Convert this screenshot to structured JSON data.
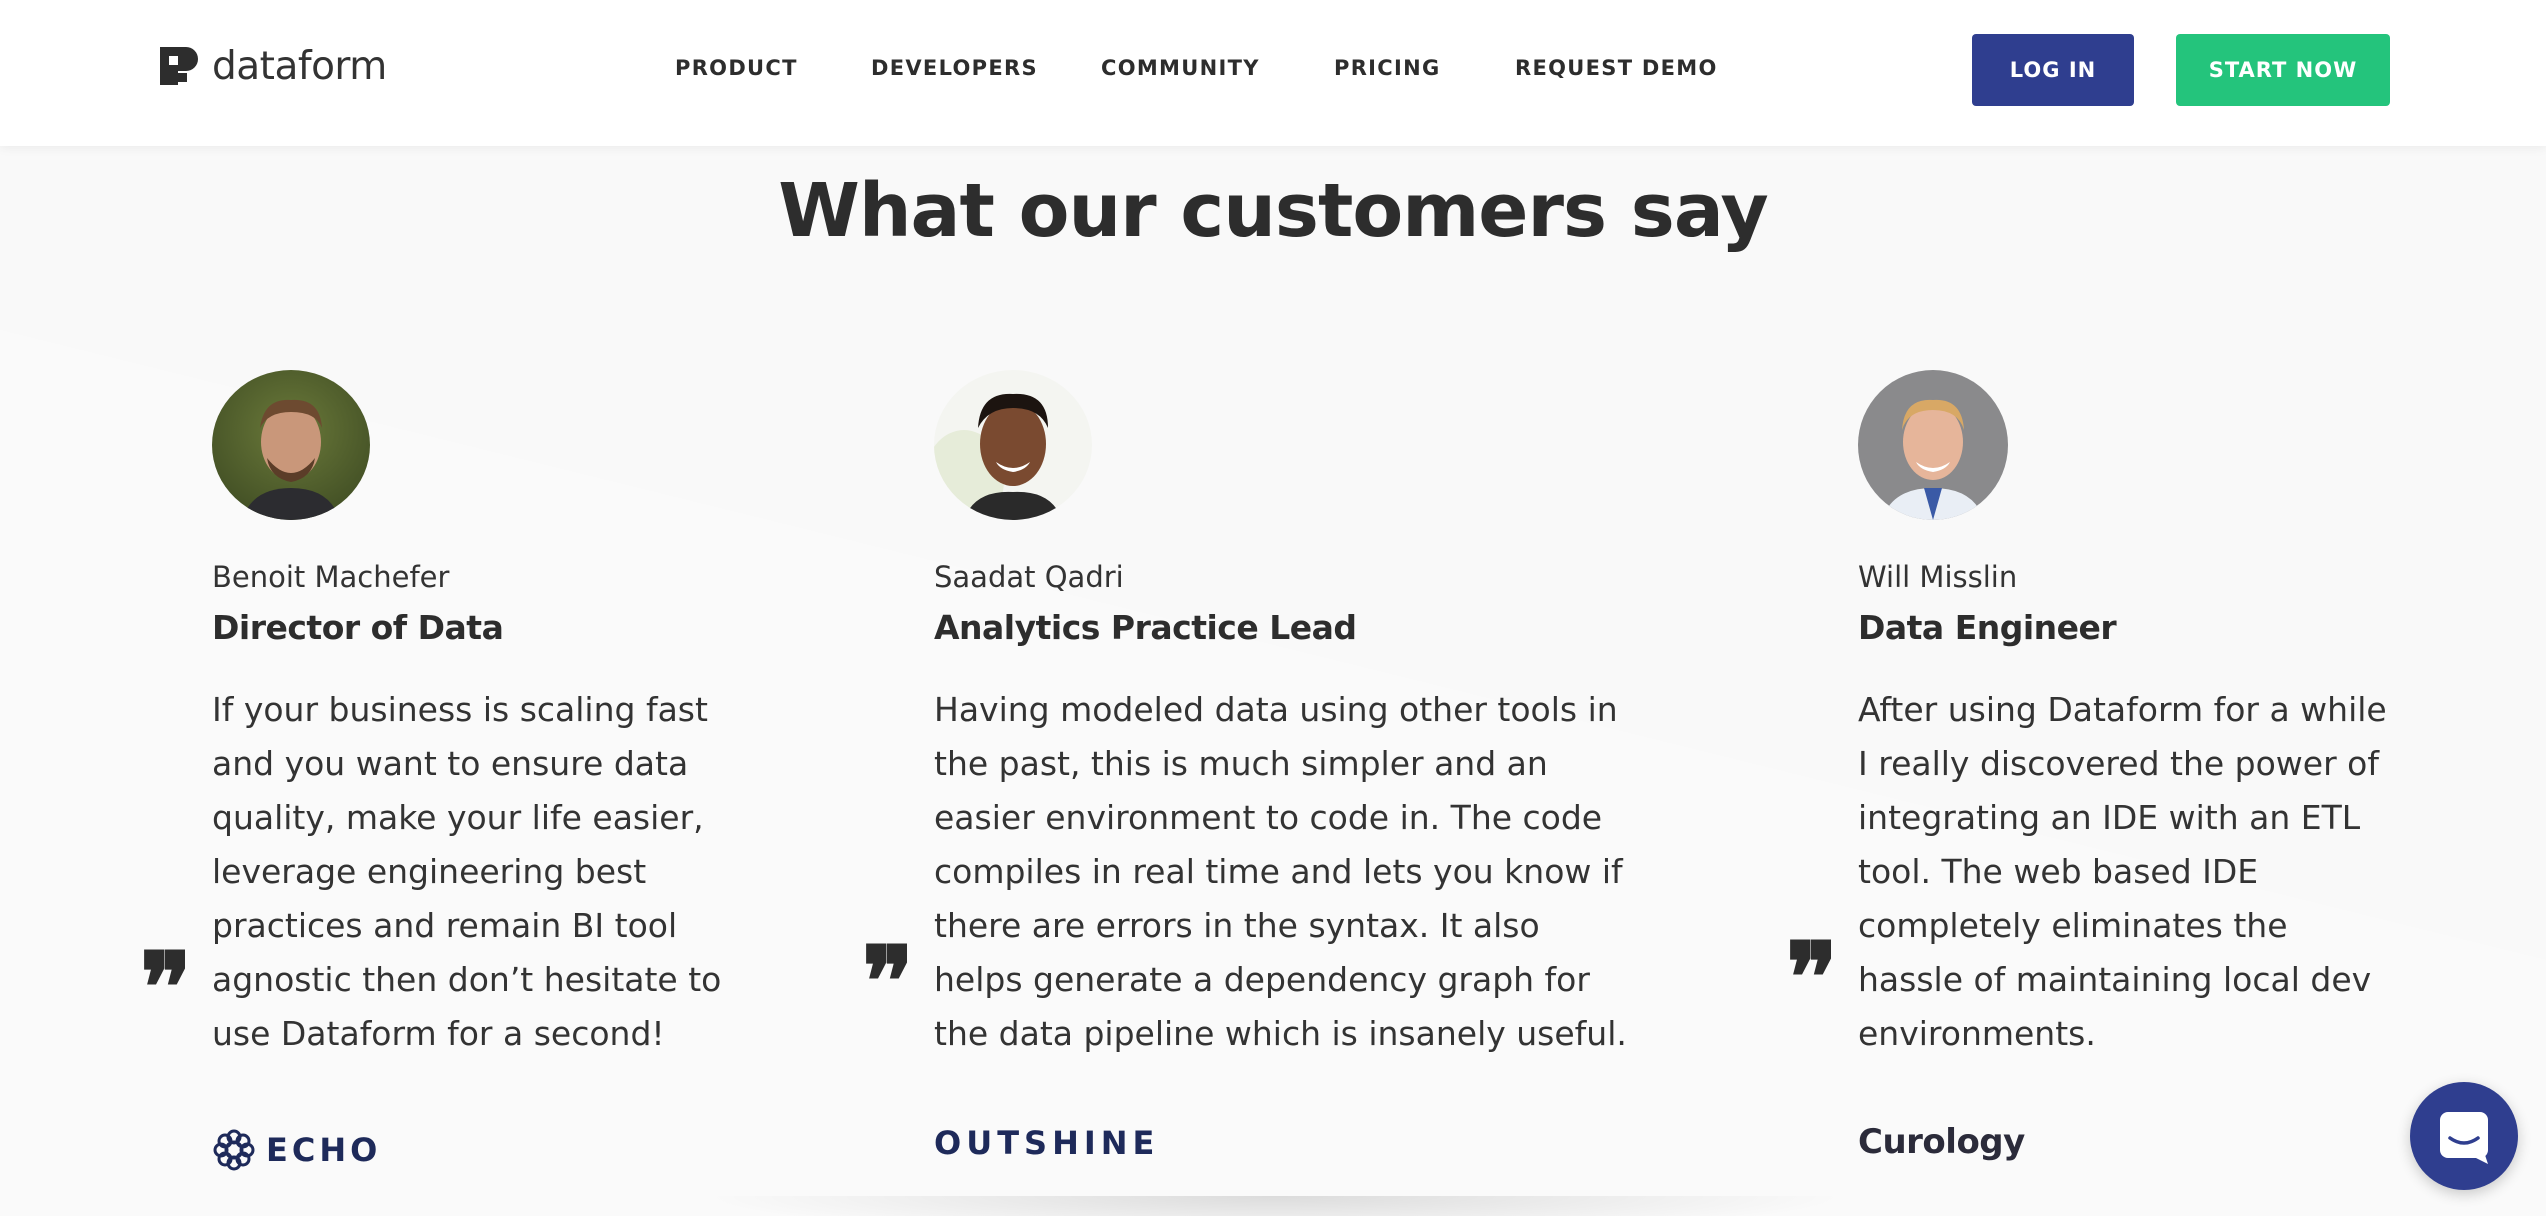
{
  "brand": {
    "name": "dataform"
  },
  "nav": {
    "items": [
      "PRODUCT",
      "DEVELOPERS",
      "COMMUNITY",
      "PRICING",
      "REQUEST DEMO"
    ],
    "login_label": "LOG IN",
    "start_label": "START NOW"
  },
  "section": {
    "title": "What our customers say"
  },
  "testimonials": [
    {
      "name": "Benoit Machefer",
      "role": "Director of Data",
      "quote": "If your business is scaling fast and you want to ensure data quality, make your life easier, leverage engineering best practices and remain BI tool agnostic then don’t hesitate to use Dataform for a second!",
      "company": "ECHO"
    },
    {
      "name": "Saadat Qadri",
      "role": "Analytics Practice Lead",
      "quote": "Having modeled data using other tools in the past, this is much simpler and an easier environment to code in. The code compiles in real time and lets you know if there are errors in the syntax. It also helps generate a dependency graph for the data pipeline which is insanely useful.",
      "company": "OUTSHINE"
    },
    {
      "name": "Will Misslin",
      "role": "Data Engineer",
      "quote": "After using Dataform for a while I really discovered the power of integrating an IDE with an ETL tool. The web based IDE completely eliminates the hassle of maintaining local dev environments.",
      "company": "Curology"
    }
  ],
  "quote_glyph": "❞",
  "colors": {
    "primary": "#2f3e8f",
    "accent": "#24c47c",
    "text": "#333333",
    "background": "#f9f9f9",
    "outshine": "#1e2a5a"
  },
  "icons": {
    "chat": "chat-icon",
    "quote": "quote-icon",
    "logo": "dataform-logo-icon"
  }
}
